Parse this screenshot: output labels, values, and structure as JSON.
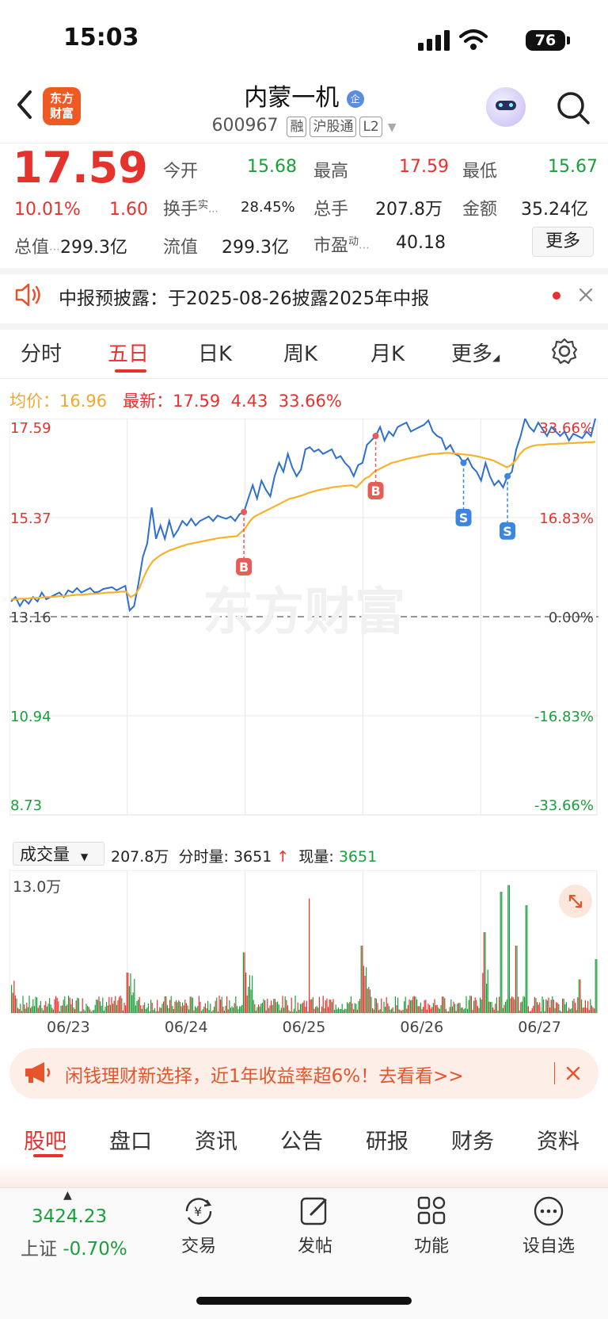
{
  "status_bar": {
    "time": "15:03",
    "battery": "76"
  },
  "header": {
    "back_icon": "chevron-left-icon",
    "logo_text": "东方\n财富",
    "stock_name": "内蒙一机",
    "name_badge": "企",
    "stock_code": "600967",
    "tags": [
      "融",
      "沪股通",
      "L2"
    ],
    "search_icon": "search-icon"
  },
  "quote": {
    "price": "17.59",
    "change_pct": "10.01%",
    "change": "1.60",
    "market_cap_label": "总值",
    "market_cap": "299.3亿",
    "fields": [
      {
        "label": "今开",
        "value": "15.68",
        "color": "green"
      },
      {
        "label": "最高",
        "value": "17.59",
        "color": "red"
      },
      {
        "label": "最低",
        "value": "15.67",
        "color": "green"
      },
      {
        "label": "换手",
        "sup": "实",
        "value": "28.45%",
        "color": "default"
      },
      {
        "label": "总手",
        "value": "207.8万",
        "color": "default"
      },
      {
        "label": "金额",
        "value": "35.24亿",
        "color": "default"
      },
      {
        "label": "流值",
        "value": "299.3亿",
        "color": "default"
      },
      {
        "label": "市盈",
        "sup": "动",
        "value": "40.18",
        "color": "default"
      }
    ],
    "more_button": "更多"
  },
  "announcement": {
    "text": "中报预披露：于2025-08-26披露2025年中报"
  },
  "period_tabs": [
    "分时",
    "五日",
    "日K",
    "周K",
    "月K",
    "更多"
  ],
  "active_period": "五日",
  "chart_legend": {
    "avg_label": "均价：",
    "avg_value": "16.96",
    "latest_label": "最新：",
    "latest_value": "17.59",
    "latest_change": "4.43",
    "latest_pct": "33.66%"
  },
  "chart_data": {
    "type": "line",
    "title": "",
    "x_labels": [
      "06/23",
      "06/24",
      "06/25",
      "06/26",
      "06/27"
    ],
    "y_ticks_left": [
      "17.59",
      "15.37",
      "13.16",
      "10.94",
      "8.73"
    ],
    "y_ticks_right": [
      "33.66%",
      "16.83%",
      "0.00%",
      "-16.83%",
      "-33.66%"
    ],
    "ylim": [
      8.73,
      17.59
    ],
    "prev_close": 13.16,
    "watermark": "东方财富",
    "series": [
      {
        "values": [
          13.5,
          13.6,
          13.4,
          13.55,
          13.45,
          13.6,
          13.5,
          13.7,
          13.55,
          13.6,
          13.65,
          13.7,
          13.6,
          13.75,
          13.7,
          13.8,
          13.7,
          13.75,
          13.8,
          13.7,
          13.72,
          13.78,
          13.8,
          13.82,
          13.75,
          13.8,
          13.85,
          13.3,
          13.4,
          13.9,
          14.5,
          14.8,
          15.6,
          14.9,
          15.2,
          14.9,
          15.3,
          14.95,
          15.1,
          15.3,
          15.2,
          15.35,
          15.2,
          15.3,
          15.35,
          15.4,
          15.3,
          15.42,
          15.38,
          15.35,
          15.4,
          15.3,
          15.45,
          15.5,
          15.8,
          16.1,
          15.8,
          16.2,
          16.0,
          15.85,
          16.3,
          16.6,
          16.4,
          16.8,
          16.5,
          16.3,
          16.45,
          16.9,
          16.95,
          16.85,
          16.9,
          16.8,
          16.85,
          16.9,
          16.7,
          16.75,
          16.6,
          16.5,
          16.3,
          16.55,
          16.6,
          17.0,
          17.1,
          17.2,
          17.4,
          17.1,
          17.3,
          17.2,
          17.4,
          17.45,
          17.5,
          17.3,
          17.35,
          17.4,
          17.45,
          17.55,
          17.3,
          17.2,
          17.15,
          16.9,
          17.0,
          16.8,
          16.75,
          16.6,
          16.7,
          16.5,
          16.4,
          16.2,
          16.6,
          16.3,
          16.1,
          16.2,
          16.05,
          16.3,
          16.4,
          16.9,
          17.2,
          17.59,
          17.4,
          17.3,
          17.5,
          17.35,
          17.2,
          17.4,
          17.3,
          17.2,
          17.3,
          17.1,
          17.25,
          17.2,
          17.15,
          17.3,
          17.2,
          17.59
        ]
      },
      {
        "values": [
          13.55,
          13.55,
          13.56,
          13.56,
          13.57,
          13.58,
          13.58,
          13.59,
          13.6,
          13.6,
          13.61,
          13.62,
          13.62,
          13.63,
          13.64,
          13.65,
          13.65,
          13.66,
          13.67,
          13.67,
          13.68,
          13.69,
          13.7,
          13.7,
          13.71,
          13.72,
          13.72,
          13.6,
          13.65,
          13.8,
          14.05,
          14.25,
          14.4,
          14.48,
          14.55,
          14.6,
          14.65,
          14.68,
          14.72,
          14.75,
          14.78,
          14.8,
          14.82,
          14.84,
          14.86,
          14.88,
          14.9,
          14.92,
          14.93,
          14.94,
          14.95,
          14.96,
          15.05,
          15.15,
          15.3,
          15.4,
          15.45,
          15.5,
          15.55,
          15.6,
          15.65,
          15.7,
          15.75,
          15.8,
          15.82,
          15.85,
          15.88,
          15.92,
          15.95,
          15.98,
          16.0,
          16.02,
          16.04,
          16.06,
          16.07,
          16.08,
          16.09,
          16.1,
          16.05,
          16.15,
          16.25,
          16.3,
          16.4,
          16.45,
          16.5,
          16.55,
          16.6,
          16.62,
          16.65,
          16.68,
          16.7,
          16.72,
          16.74,
          16.76,
          16.78,
          16.8,
          16.8,
          16.81,
          16.82,
          16.82,
          16.81,
          16.8,
          16.79,
          16.78,
          16.77,
          16.75,
          16.73,
          16.7,
          16.68,
          16.65,
          16.6,
          16.55,
          16.5,
          16.55,
          16.65,
          16.8,
          16.9,
          16.95,
          16.98,
          17.0,
          17.0,
          17.01,
          17.02,
          17.02,
          17.03,
          17.03,
          17.04,
          17.04,
          17.05,
          17.05,
          17.06,
          17.06,
          17.07
        ]
      }
    ],
    "trade_markers": [
      "B",
      "B",
      "S",
      "S"
    ]
  },
  "volume": {
    "dropdown_label": "成交量",
    "total": "207.8万",
    "minute_label": "分时量:",
    "minute_value": "3651",
    "current_label": "现量:",
    "current_value": "3651",
    "max_label": "13.0万"
  },
  "banner": {
    "text": "闲钱理财新选择，近1年收益率超6%！去看看>>",
    "megaphone_icon": "megaphone-icon"
  },
  "sub_tabs": [
    "股吧",
    "盘口",
    "资讯",
    "公告",
    "研报",
    "财务",
    "资料"
  ],
  "active_sub_tab": "股吧",
  "bottom_nav": {
    "index_value": "3424.23",
    "index_name": "上证",
    "index_change": "-0.70%",
    "items": [
      {
        "label": "交易",
        "icon": "yen-cycle-icon"
      },
      {
        "label": "发帖",
        "icon": "edit-icon"
      },
      {
        "label": "功能",
        "icon": "grid-icon"
      },
      {
        "label": "设自选",
        "icon": "more-circle-icon"
      }
    ]
  }
}
